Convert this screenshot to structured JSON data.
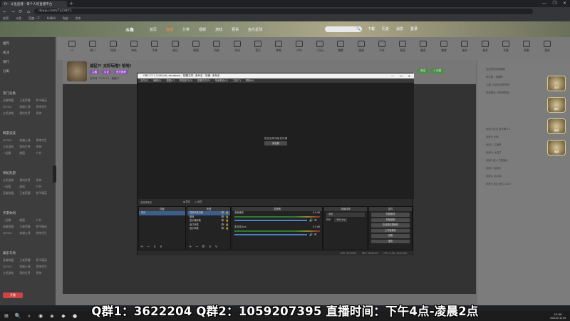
{
  "browser": {
    "tab_title": "Pr · 斗鱼直播 - 每个人的直播平台",
    "new_tab": "+",
    "window_controls": [
      "—",
      "❐",
      "✕"
    ],
    "nav": [
      "←",
      "→",
      "⟳",
      "⌂"
    ],
    "url": "douyu.com/7223471",
    "bookmarks": [
      "应用",
      "斗鱼",
      "百度一下",
      "bilibili",
      "淘宝",
      "京东"
    ]
  },
  "site": {
    "brand": "斗鱼",
    "nav": [
      {
        "label": "首页",
        "active": false
      },
      {
        "label": "直播",
        "active": true
      },
      {
        "label": "分类",
        "active": false
      },
      {
        "label": "视频",
        "active": false
      },
      {
        "label": "游戏",
        "active": false
      },
      {
        "label": "赛事",
        "active": false
      },
      {
        "label": "鱼乐星球",
        "active": false
      }
    ],
    "search_icon": "🔍",
    "top_actions": [
      "下载",
      "历史",
      "消息",
      "登录"
    ]
  },
  "sidebar": {
    "items": [
      "推荐",
      "关注",
      "排行",
      "分类"
    ],
    "section_headers": [
      "热门分类",
      "网游竞技",
      "单机热游",
      "手游休闲",
      "娱乐天地"
    ],
    "grid": [
      "英雄联盟",
      "王者荣耀",
      "和平精英",
      "DOTA2",
      "穿越火线",
      "绝地求生",
      "主机游戏",
      "我的世界",
      "原神",
      "一起看",
      "颜值",
      "户外"
    ],
    "bottom_button": "开播"
  },
  "categories": [
    "12",
    "热门",
    "网游",
    "单机",
    "手游",
    "娱乐",
    "颜值",
    "科技",
    "文化",
    "音乐",
    "体育",
    "户外",
    "二次元",
    "美食",
    "旅游",
    "汽车",
    "萌宠",
    "健身",
    "教育",
    "电台",
    "星秀",
    "军事",
    "赛事",
    "更多"
  ],
  "room": {
    "title": "战区?! 太好玩啦! 哈哈!",
    "tags": [
      "主播",
      "认证",
      "官方推荐"
    ],
    "subtitle": "房间号 7223471 · 直播中",
    "buttons": [
      "关注",
      "+ 订阅"
    ]
  },
  "obs": {
    "title": "OBS 27.1.3 (64-bit, windows) - 配置文件: 未命名 - 场景: 未命名",
    "window_controls": [
      "—",
      "☐",
      "✕"
    ],
    "menu": [
      "文件(F)",
      "编辑(E)",
      "视图(V)",
      "停靠窗口(D)",
      "配置文件(P)",
      "场景集合(S)",
      "工具(T)",
      "帮助(H)"
    ],
    "no_source_text": "您还没有添加任何源",
    "no_source_button": "添加源",
    "scene_info": "未选择场景",
    "view_toggles": [
      "◉ 属性",
      "◎ 滤镜"
    ],
    "docks": {
      "scenes": {
        "title": "场景",
        "items": [
          "场景"
        ]
      },
      "sources": {
        "title": "来源",
        "items": [
          "视频采集设备",
          "图像",
          "显示器采集",
          "窗口采集",
          "显示采集"
        ]
      },
      "mixer": {
        "title": "混音器",
        "channels": [
          "桌面音频",
          "麦克风/Aux"
        ],
        "db": "0.0 dB"
      },
      "transitions": {
        "title": "场景转场",
        "mode": "淡出",
        "duration_label": "时长",
        "duration": "300 ms"
      },
      "controls": {
        "title": "控件",
        "buttons": [
          "开始推流",
          "开始录制",
          "启动虚拟摄像机",
          "工作室模式",
          "设置",
          "退出"
        ]
      }
    },
    "footer_icons": [
      "+",
      "−",
      "∧",
      "∨"
    ],
    "status": [
      "LIVE: 00:00:00",
      "REC: 00:00:00",
      "CPU: 2.3%, 30.00 fps"
    ]
  },
  "right_panel": {
    "chat_lines": [
      "欢迎来到本直播间",
      "粉丝团 · 贡献榜",
      "主播: 今天玩点新东西",
      "系统提示: 请文明发言",
      "玩家A 送出 荧光棒 x1",
      "玩家B: 666",
      "玩家C: 主播好",
      "玩家D: 太强了",
      "玩家E 进入了直播间",
      "玩家F: 哈哈哈",
      "玩家G: 冲冲冲",
      "玩家H 送出 鱼丸 x100"
    ],
    "floaters": [
      "活动",
      "福利",
      "抽奖",
      "宝箱"
    ]
  },
  "overlay_text": "Q群1：3622204  Q群2：1059207395   直播时间：下午4点-凌晨2点",
  "taskbar": {
    "icons": [
      "⊞",
      "🔍",
      "⌕",
      "◉",
      "◈",
      "◆",
      "●"
    ],
    "time": "15:06",
    "date": "2022/11/19"
  }
}
